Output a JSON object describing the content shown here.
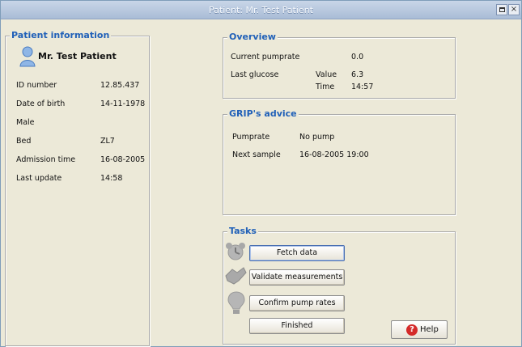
{
  "window": {
    "title": "Patient: Mr. Test Patient",
    "maximize_label": "",
    "close_label": "×"
  },
  "patient_info": {
    "legend": "Patient information",
    "name": "Mr. Test Patient",
    "rows": [
      {
        "label": "ID number",
        "value": "12.85.437"
      },
      {
        "label": "Date of birth",
        "value": "14-11-1978"
      },
      {
        "label": "Male",
        "value": ""
      },
      {
        "label": "Bed",
        "value": "ZL7"
      },
      {
        "label": "Admission time",
        "value": "16-08-2005"
      },
      {
        "label": "Last update",
        "value": "14:58"
      }
    ]
  },
  "overview": {
    "legend": "Overview",
    "current_pumprate_label": "Current pumprate",
    "current_pumprate_value": "0.0",
    "last_glucose_label": "Last glucose",
    "value_label": "Value",
    "value": "6.3",
    "time_label": "Time",
    "time": "14:57"
  },
  "advice": {
    "legend": "GRIP's advice",
    "pumprate_label": "Pumprate",
    "pumprate_value": "No pump",
    "next_sample_label": "Next sample",
    "next_sample_value": "16-08-2005 19:00"
  },
  "tasks": {
    "legend": "Tasks",
    "fetch_label": "Fetch data",
    "validate_label": "Validate measurements",
    "confirm_label": "Confirm pump rates",
    "finished_label": "Finished",
    "help_label": "Help",
    "icons": [
      "alarm-clock-icon",
      "handshake-icon",
      "lightbulb-icon"
    ]
  },
  "colors": {
    "accent": "#2060b8",
    "background": "#ece9d8",
    "titlebar": "#b7c8df",
    "help_icon": "#d42a2a"
  }
}
